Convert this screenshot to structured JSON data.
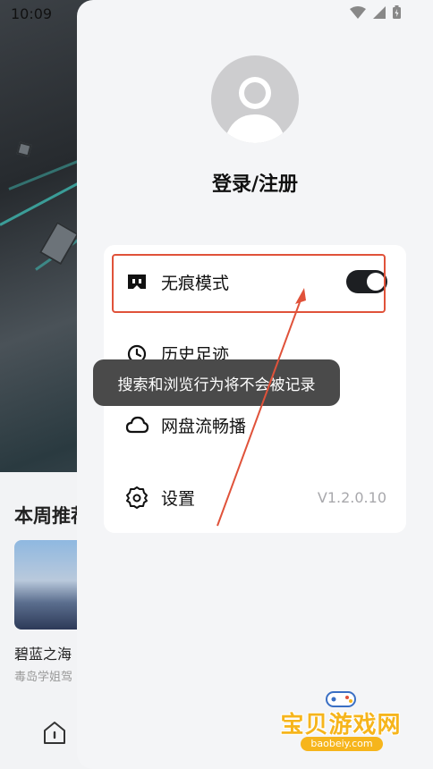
{
  "status_bar": {
    "time": "10:09"
  },
  "background": {
    "section_title": "本周推荐",
    "card_title": "碧蓝之海",
    "card_subtitle": "毒岛学姐驾"
  },
  "drawer": {
    "login_title": "登录/注册",
    "menu": [
      {
        "label": "无痕模式",
        "icon": "incognito-mask-icon",
        "toggle_on": true
      },
      {
        "label": "历史足迹",
        "icon": "history-clock-icon"
      },
      {
        "label": "网盘流畅播",
        "icon": "cloud-icon"
      },
      {
        "label": "设置",
        "icon": "gear-icon",
        "version": "V1.2.0.10"
      }
    ],
    "tooltip": "搜索和浏览行为将不会被记录"
  },
  "watermark": {
    "title": "宝贝游戏网",
    "url": "baobeiy.com"
  },
  "colors": {
    "highlight": "#e0523a",
    "toggle_on": "#1d1f22",
    "watermark": "#f6b51c"
  }
}
